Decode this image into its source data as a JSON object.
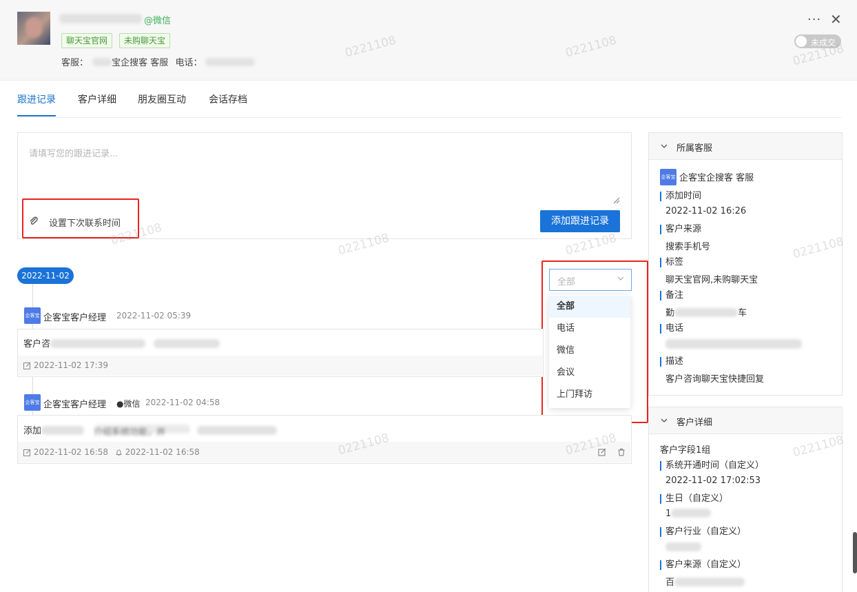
{
  "contact": {
    "source_tag": "@微信",
    "tags": [
      "聊天宝官网",
      "未购聊天宝"
    ],
    "staff_label": "客服：",
    "staff_name": "宝企搜客 客服",
    "phone_label": "电话：",
    "deal_status": "未成交"
  },
  "tabs": [
    "跟进记录",
    "客户详细",
    "朋友圈互动",
    "会话存档"
  ],
  "editor": {
    "placeholder": "请填写您的跟进记录...",
    "set_next_time": "设置下次联系时间",
    "add_button": "添加跟进记录"
  },
  "timeline": {
    "date": "2022-11-02",
    "filter_value": "全部",
    "filter_options": [
      "全部",
      "电话",
      "微信",
      "会议",
      "上门拜访"
    ],
    "records": [
      {
        "logo": "企客宝",
        "author": "企客宝客户经理",
        "channel": "",
        "time": "2022-11-02 05:39",
        "content_prefix": "客户咨",
        "edit_time": "2022-11-02 17:39",
        "remind_time": ""
      },
      {
        "logo": "企客宝",
        "author": "企客宝客户经理",
        "channel": "●微信",
        "time": "2022-11-02 04:58",
        "content_prefix": "添加",
        "content_mid": "介绍系统功能，并",
        "edit_time": "2022-11-02 16:58",
        "remind_time": "2022-11-02 16:58"
      }
    ]
  },
  "side_staff": {
    "title": "所属客服",
    "logo": "企客宝",
    "name": "企客宝企搜客 客服",
    "fields": [
      {
        "label": "添加时间",
        "value": "2022-11-02 16:26"
      },
      {
        "label": "客户来源",
        "value": "搜索手机号"
      },
      {
        "label": "标签",
        "value": "聊天宝官网,未购聊天宝"
      },
      {
        "label": "备注",
        "value": "勤",
        "value_suffix": "车"
      },
      {
        "label": "电话",
        "value": ""
      },
      {
        "label": "描述",
        "value": "客户咨询聊天宝快捷回复"
      }
    ]
  },
  "side_detail": {
    "title": "客户详细",
    "group": "客户字段1组",
    "fields": [
      {
        "label": "系统开通时间（自定义）",
        "value": "2022-11-02 17:02:53"
      },
      {
        "label": "生日（自定义）",
        "value": "1"
      },
      {
        "label": "客户行业（自定义）",
        "value": ""
      },
      {
        "label": "客户来源（自定义）",
        "value": "百"
      }
    ]
  },
  "watermark": "0221108",
  "colors": {
    "accent": "#1a73d8",
    "highlight_box": "#e8231c",
    "tag_green": "#3bb15b"
  }
}
